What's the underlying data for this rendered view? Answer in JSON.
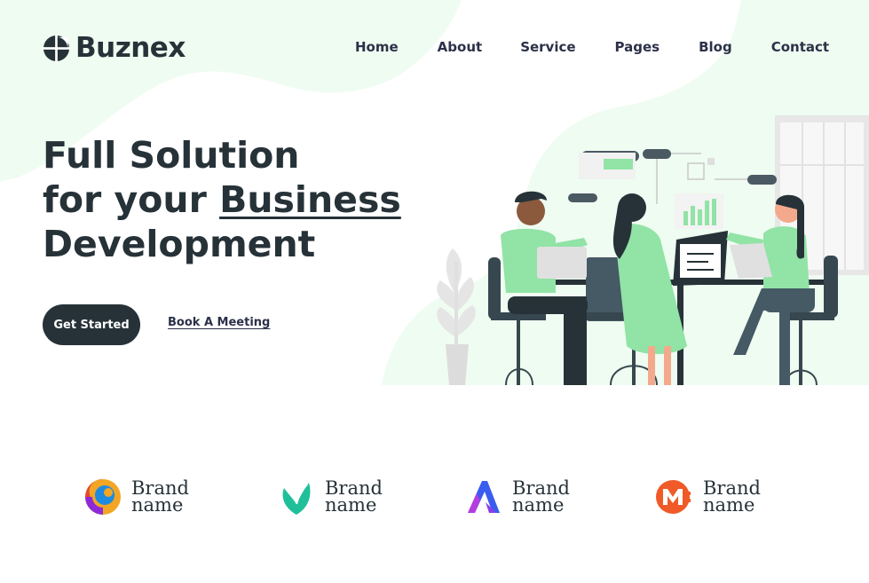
{
  "brand": {
    "name": "Buznex",
    "mark_icon": "buznex-logo-icon"
  },
  "nav": {
    "items": [
      {
        "label": "Home"
      },
      {
        "label": "About"
      },
      {
        "label": "Service"
      },
      {
        "label": "Pages"
      },
      {
        "label": "Blog"
      },
      {
        "label": "Contact"
      }
    ]
  },
  "hero": {
    "line1": "Full Solution",
    "line2_prefix": "for your ",
    "line2_accent": "Business",
    "line3": "Development",
    "cta_primary": "Get Started",
    "cta_secondary": "Book A Meeting",
    "illustration": "team-meeting-illustration"
  },
  "partners": [
    {
      "line1": "Brand",
      "line2": "name",
      "icon": "orb-logo-icon"
    },
    {
      "line1": "Brand",
      "line2": "name",
      "icon": "leaf-logo-icon"
    },
    {
      "line1": "Brand",
      "line2": "name",
      "icon": "letter-a-logo-icon"
    },
    {
      "line1": "Brand",
      "line2": "name",
      "icon": "letter-m-logo-icon"
    }
  ],
  "colors": {
    "primary_dark": "#263238",
    "nav_text": "#2c3149",
    "mint_background": "#effcf1",
    "green_accent": "#91e3a6"
  }
}
